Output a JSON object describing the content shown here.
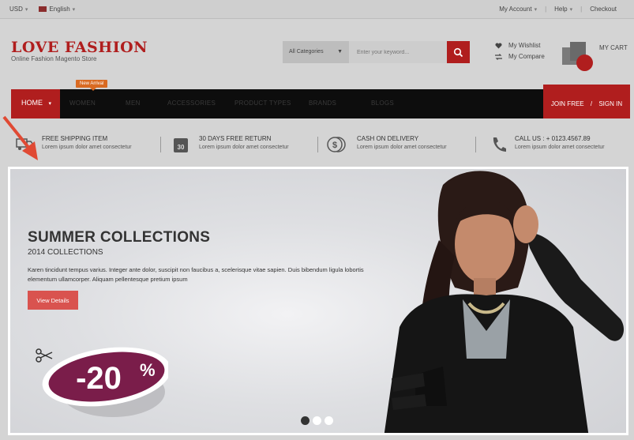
{
  "topbar": {
    "currency": "USD",
    "language": "English",
    "my_account": "My Account",
    "help": "Help",
    "checkout": "Checkout"
  },
  "header": {
    "logo": "LOVE FASHION",
    "tagline": "Online Fashion Magento Store",
    "search_category": "All Categories",
    "search_placeholder": "Enter your keyword...",
    "wishlist": "My Wishlist",
    "compare": "My Compare",
    "cart": "MY CART"
  },
  "nav": {
    "home": "HOME",
    "badge": "New Arrival",
    "items": [
      "WOMEN",
      "MEN",
      "ACCESSORIES",
      "PRODUCT TYPES",
      "BRANDS",
      "BLOGS"
    ],
    "join": "JOIN FREE",
    "sep": "/",
    "sign_in": "SIGN IN"
  },
  "features": [
    {
      "title": "FREE SHIPPING ITEM",
      "desc": "Lorem ipsum dolor amet consectetur",
      "icon": "truck-icon"
    },
    {
      "title": "30 DAYS FREE RETURN",
      "desc": "Lorem ipsum dolor amet consectetur",
      "icon": "calendar-icon"
    },
    {
      "title": "CASH ON DELIVERY",
      "desc": "Lorem ipsum dolor amet consectetur",
      "icon": "coins-icon"
    },
    {
      "title": "CALL US : + 0123.4567.89",
      "desc": "Lorem ipsum dolor amet consectetur",
      "icon": "phone-icon"
    }
  ],
  "hero": {
    "title": "SUMMER COLLECTIONS",
    "subtitle": "2014 COLLECTIONS",
    "description": "Karen tincidunt tempus varius. Integer ante dolor, suscipit non faucibus a, scelerisque vitae sapien. Duis bibendum ligula lobortis elementum ullamcorper. Aliquam pellentesque pretium ipsum",
    "button": "View Details",
    "discount": "-20",
    "percent": "%",
    "slides": 3,
    "active_slide": 1
  },
  "colors": {
    "brand": "#b01e1e",
    "button": "#d9534f",
    "badge": "#d96a22",
    "discount": "#7a1d4a"
  }
}
